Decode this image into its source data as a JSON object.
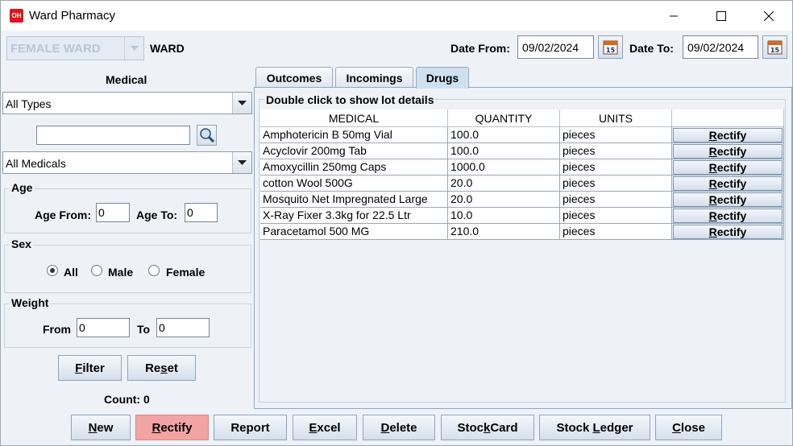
{
  "window": {
    "app_icon": "OH",
    "title": "Ward Pharmacy"
  },
  "icons": {
    "minimize": "minimize-icon",
    "maximize": "maximize-icon",
    "close": "close-icon",
    "calendar": "calendar-icon",
    "search": "magnifier-icon",
    "dropdown": "chevron-down-icon"
  },
  "ward": {
    "selected": "FEMALE WARD",
    "label": "WARD"
  },
  "dates": {
    "from_label": "Date From:",
    "from_value": "09/02/2024",
    "to_label": "Date To:",
    "to_value": "09/02/2024",
    "calendar_day": "15"
  },
  "filter_panel": {
    "title": "Medical",
    "type_selected": "All Types",
    "search_value": "",
    "medical_selected": "All Medicals",
    "age": {
      "title": "Age",
      "from_label": "Age From:",
      "from_value": "0",
      "to_label": "Age To:",
      "to_value": "0"
    },
    "sex": {
      "title": "Sex",
      "options": [
        "All",
        "Male",
        "Female"
      ],
      "selected": "All"
    },
    "weight": {
      "title": "Weight",
      "from_label": "From",
      "from_value": "0",
      "to_label": "To",
      "to_value": "0"
    },
    "filter_button": "Filter",
    "reset_button": "Reset",
    "count_label": "Count: 0"
  },
  "tabs": [
    {
      "label": "Outcomes",
      "active": false
    },
    {
      "label": "Incomings",
      "active": false
    },
    {
      "label": "Drugs",
      "active": true
    }
  ],
  "drugs_table": {
    "caption": "Double click to show lot details",
    "columns": [
      "MEDICAL",
      "QUANTITY",
      "UNITS",
      ""
    ],
    "row_action": "Rectify",
    "rows": [
      {
        "medical": "Amphotericin B 50mg Vial",
        "quantity": "100.0",
        "units": "pieces"
      },
      {
        "medical": "Acyclovir 200mg Tab",
        "quantity": "100.0",
        "units": "pieces"
      },
      {
        "medical": "Amoxycillin 250mg Caps",
        "quantity": "1000.0",
        "units": "pieces"
      },
      {
        "medical": "cotton Wool 500G",
        "quantity": "20.0",
        "units": "pieces"
      },
      {
        "medical": "Mosquito Net Impregnated Large",
        "quantity": "20.0",
        "units": "pieces"
      },
      {
        "medical": "X-Ray Fixer 3.3kg for 22.5 Ltr",
        "quantity": "10.0",
        "units": "pieces"
      },
      {
        "medical": "Paracetamol 500 MG",
        "quantity": "210.0",
        "units": "pieces"
      }
    ]
  },
  "bottom_buttons": [
    {
      "pre": "",
      "mn": "N",
      "post": "ew",
      "active": false
    },
    {
      "pre": "",
      "mn": "R",
      "post": "ectify",
      "active": true
    },
    {
      "pre": "Report",
      "mn": "",
      "post": "",
      "active": false
    },
    {
      "pre": "",
      "mn": "E",
      "post": "xcel",
      "active": false
    },
    {
      "pre": "",
      "mn": "D",
      "post": "elete",
      "active": false
    },
    {
      "pre": "Stoc",
      "mn": "k",
      "post": "Card",
      "active": false
    },
    {
      "pre": "Stock ",
      "mn": "L",
      "post": "edger",
      "active": false
    },
    {
      "pre": "",
      "mn": "C",
      "post": "lose",
      "active": false
    }
  ],
  "colors": {
    "active_tab": "#cfe0f1",
    "active_button": "#f4a3a3",
    "app_icon": "#e0141c"
  }
}
